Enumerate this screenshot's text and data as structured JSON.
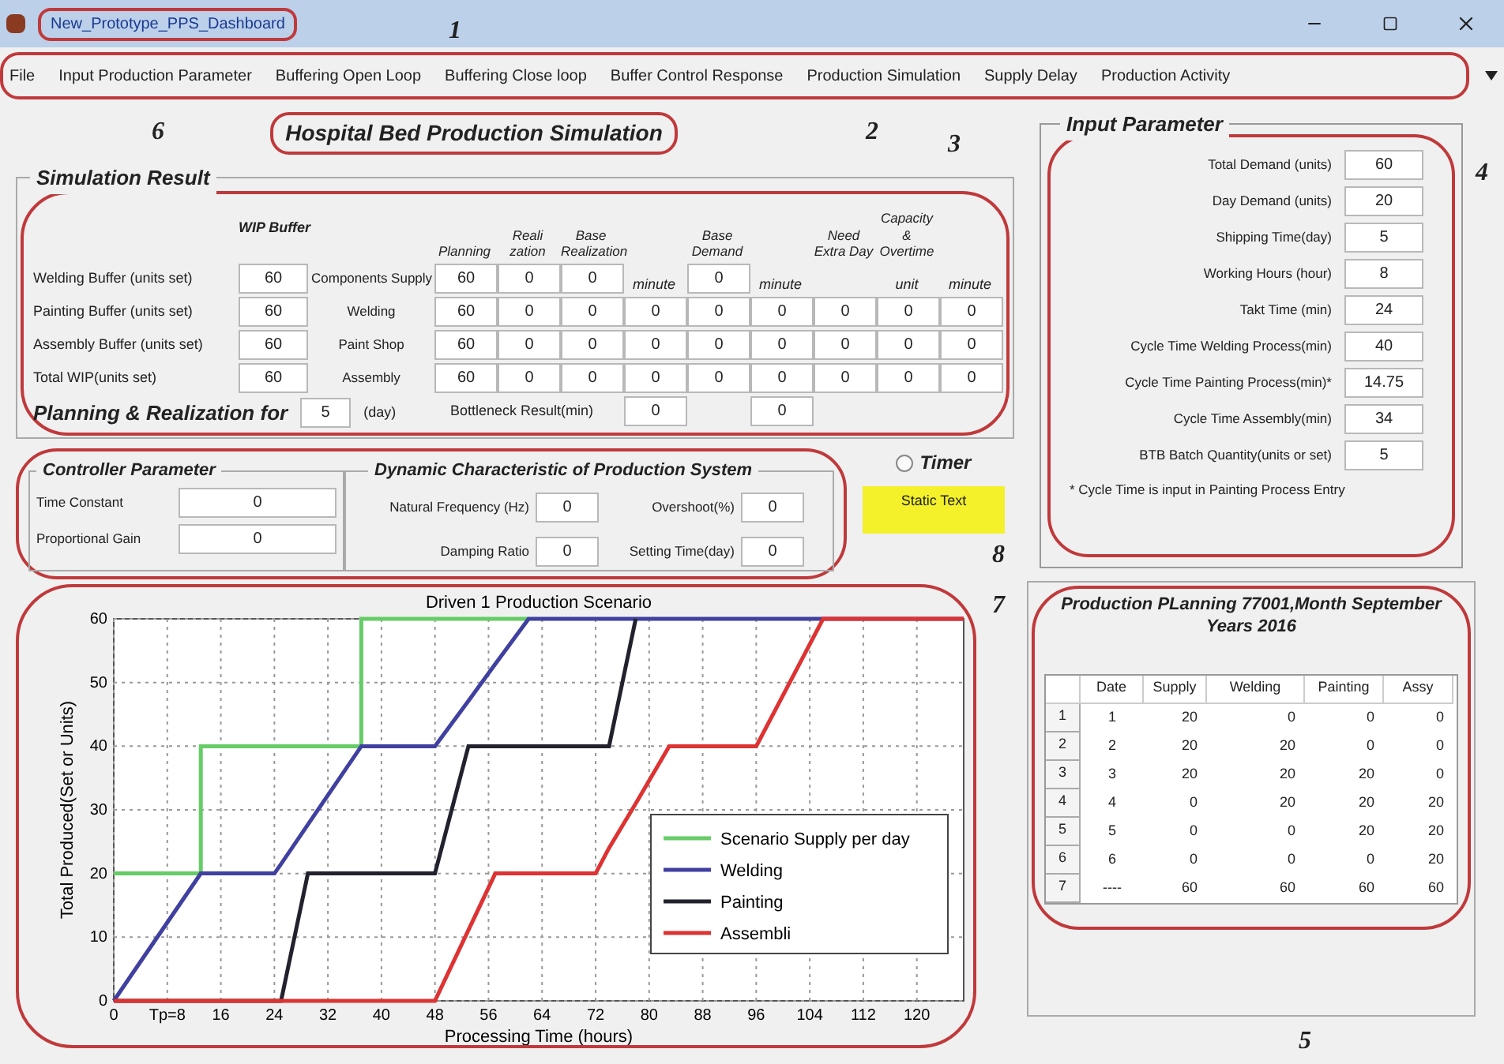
{
  "window": {
    "title": "New_Prototype_PPS_Dashboard"
  },
  "menu": [
    "File",
    "Input Production Parameter",
    "Buffering Open Loop",
    "Buffering Close loop",
    "Buffer Control Response",
    "Production Simulation",
    "Supply Delay",
    "Production Activity"
  ],
  "heading": "Hospital Bed Production Simulation",
  "simulation_result": {
    "title": "Simulation Result",
    "wip_header": "WIP Buffer",
    "buffers": [
      {
        "label": "Welding Buffer (units set)",
        "value": "60"
      },
      {
        "label": "Painting  Buffer (units set)",
        "value": "60"
      },
      {
        "label": "Assembly  Buffer (units set)",
        "value": "60"
      },
      {
        "label": "Total WIP(units set)",
        "value": "60"
      }
    ],
    "columns": [
      "Planning",
      "Reali zation",
      "Base Realization",
      "",
      "Base Demand",
      "",
      "Need Extra Day",
      "Capacity & Overtime",
      ""
    ],
    "rows": [
      {
        "label": "Components Supply",
        "cells": [
          {
            "kind": "value",
            "text": "60"
          },
          {
            "kind": "value",
            "text": "0"
          },
          {
            "kind": "value",
            "text": "0"
          },
          {
            "kind": "label",
            "text": "minute"
          },
          {
            "kind": "value",
            "text": "0"
          },
          {
            "kind": "label",
            "text": "minute"
          },
          {
            "kind": "blank"
          },
          {
            "kind": "label",
            "text": "unit"
          },
          {
            "kind": "label",
            "text": "minute"
          }
        ]
      },
      {
        "label": "Welding",
        "cells": [
          {
            "kind": "value",
            "text": "60"
          },
          {
            "kind": "value",
            "text": "0"
          },
          {
            "kind": "value",
            "text": "0"
          },
          {
            "kind": "value",
            "text": "0"
          },
          {
            "kind": "value",
            "text": "0"
          },
          {
            "kind": "value",
            "text": "0"
          },
          {
            "kind": "value",
            "text": "0"
          },
          {
            "kind": "value",
            "text": "0"
          },
          {
            "kind": "value",
            "text": "0"
          }
        ]
      },
      {
        "label": "Paint Shop",
        "cells": [
          {
            "kind": "value",
            "text": "60"
          },
          {
            "kind": "value",
            "text": "0"
          },
          {
            "kind": "value",
            "text": "0"
          },
          {
            "kind": "value",
            "text": "0"
          },
          {
            "kind": "value",
            "text": "0"
          },
          {
            "kind": "value",
            "text": "0"
          },
          {
            "kind": "value",
            "text": "0"
          },
          {
            "kind": "value",
            "text": "0"
          },
          {
            "kind": "value",
            "text": "0"
          }
        ]
      },
      {
        "label": "Assembly",
        "cells": [
          {
            "kind": "value",
            "text": "60"
          },
          {
            "kind": "value",
            "text": "0"
          },
          {
            "kind": "value",
            "text": "0"
          },
          {
            "kind": "value",
            "text": "0"
          },
          {
            "kind": "value",
            "text": "0"
          },
          {
            "kind": "value",
            "text": "0"
          },
          {
            "kind": "value",
            "text": "0"
          },
          {
            "kind": "value",
            "text": "0"
          },
          {
            "kind": "value",
            "text": "0"
          }
        ]
      }
    ],
    "planning": {
      "label": "Planning  & Realization for",
      "value": "5",
      "unit": "(day)"
    },
    "bottleneck": {
      "label": "Bottleneck Result(min)",
      "cells": [
        {
          "kind": "value",
          "text": "0"
        },
        {
          "kind": "blank"
        },
        {
          "kind": "value",
          "text": "0"
        },
        {
          "kind": "blank"
        },
        {
          "kind": "blank"
        },
        {
          "kind": "blank"
        }
      ]
    }
  },
  "controller": {
    "title": "Controller Parameter",
    "fields": [
      {
        "label": "Time Constant",
        "value": "0"
      },
      {
        "label": "Proportional Gain",
        "value": "0"
      }
    ]
  },
  "dynamics": {
    "title": "Dynamic Characteristic of  Production System",
    "fields": [
      {
        "label": "Natural Frequency (Hz)",
        "value": "0"
      },
      {
        "label": "Overshoot(%)",
        "value": "0"
      },
      {
        "label": "Damping Ratio",
        "value": "0"
      },
      {
        "label": "Setting Time(day)",
        "value": "0"
      }
    ]
  },
  "timer": {
    "label": "Timer",
    "selected": false
  },
  "static_text": "Static Text",
  "chart": {
    "chart_data": {
      "type": "line",
      "title": "Driven 1 Production Scenario",
      "xlabel": "Processing Time (hours)",
      "ylabel": "Total Produced(Set or Units)",
      "x": [
        0,
        13,
        13,
        24,
        25,
        29,
        37,
        37,
        48,
        48,
        53,
        57,
        62,
        72,
        74,
        78,
        83,
        96,
        106,
        127
      ],
      "series": [
        {
          "name": "Scenario Supply per day",
          "color": "#66cc66",
          "values": [
            20,
            20,
            40,
            40,
            40,
            40,
            40,
            60,
            60,
            60,
            60,
            60,
            60,
            null,
            null,
            null,
            null,
            null,
            null,
            null
          ]
        },
        {
          "name": "Welding",
          "color": "#4040a0",
          "values": [
            0,
            20,
            20,
            20,
            21.5,
            27.7,
            40,
            40,
            40,
            40,
            47.1,
            52.9,
            60,
            60,
            60,
            60,
            60,
            60,
            60,
            60
          ]
        },
        {
          "name": "Painting",
          "color": "#22222e",
          "values": [
            0,
            0,
            0,
            0,
            0,
            20,
            20,
            20,
            20,
            20,
            40,
            40,
            40,
            40,
            40,
            60,
            null,
            null,
            null,
            null
          ]
        },
        {
          "name": "Assembli",
          "color": "#dd3333",
          "values": [
            0,
            0,
            0,
            0,
            0,
            0,
            0,
            0,
            0,
            0,
            11.1,
            20,
            20,
            20,
            24,
            31,
            40,
            40,
            60,
            60
          ]
        }
      ],
      "xlim": [
        0,
        127
      ],
      "ylim": [
        0,
        60
      ],
      "xticks": [
        0,
        {
          "value": 8,
          "label": "Tp=8"
        },
        16,
        24,
        32,
        40,
        48,
        56,
        64,
        72,
        80,
        88,
        96,
        104,
        112,
        120
      ],
      "yticks": [
        0,
        10,
        20,
        30,
        40,
        50,
        60
      ],
      "grid": true,
      "legend": true
    }
  },
  "input_parameter": {
    "title": "Input Parameter",
    "fields": [
      {
        "label": "Total Demand (units)",
        "value": "60"
      },
      {
        "label": "Day Demand (units)",
        "value": "20"
      },
      {
        "label": "Shipping Time(day)",
        "value": "5"
      },
      {
        "label": "Working Hours (hour)",
        "value": "8"
      },
      {
        "label": "Takt Time (min)",
        "value": "24"
      },
      {
        "label": "Cycle Time Welding Process(min)",
        "value": "40"
      },
      {
        "label": "Cycle Time Painting Process(min)*",
        "value": "14.75"
      },
      {
        "label": "Cycle Time Assembly(min)",
        "value": "34"
      },
      {
        "label": "BTB Batch Quantity(units or set)",
        "value": "5"
      }
    ],
    "note": "* Cycle Time  is input in Painting Process Entry"
  },
  "planning_table": {
    "title": "Production PLanning 77001,Month September Years 2016",
    "columns": [
      "Date",
      "Supply",
      "Welding",
      "Painting",
      "Assy"
    ],
    "rows": [
      {
        "header": "1",
        "cells": [
          "1",
          "20",
          "0",
          "0",
          "0"
        ]
      },
      {
        "header": "2",
        "cells": [
          "2",
          "20",
          "20",
          "0",
          "0"
        ]
      },
      {
        "header": "3",
        "cells": [
          "3",
          "20",
          "20",
          "20",
          "0"
        ]
      },
      {
        "header": "4",
        "cells": [
          "4",
          "0",
          "20",
          "20",
          "20"
        ]
      },
      {
        "header": "5",
        "cells": [
          "5",
          "0",
          "0",
          "20",
          "20"
        ]
      },
      {
        "header": "6",
        "cells": [
          "6",
          "0",
          "0",
          "0",
          "20"
        ]
      },
      {
        "header": "7",
        "cells": [
          "----",
          "60",
          "60",
          "60",
          "60"
        ]
      }
    ]
  },
  "annotations": [
    "1",
    "2",
    "3",
    "4",
    "5",
    "6",
    "7",
    "8"
  ]
}
